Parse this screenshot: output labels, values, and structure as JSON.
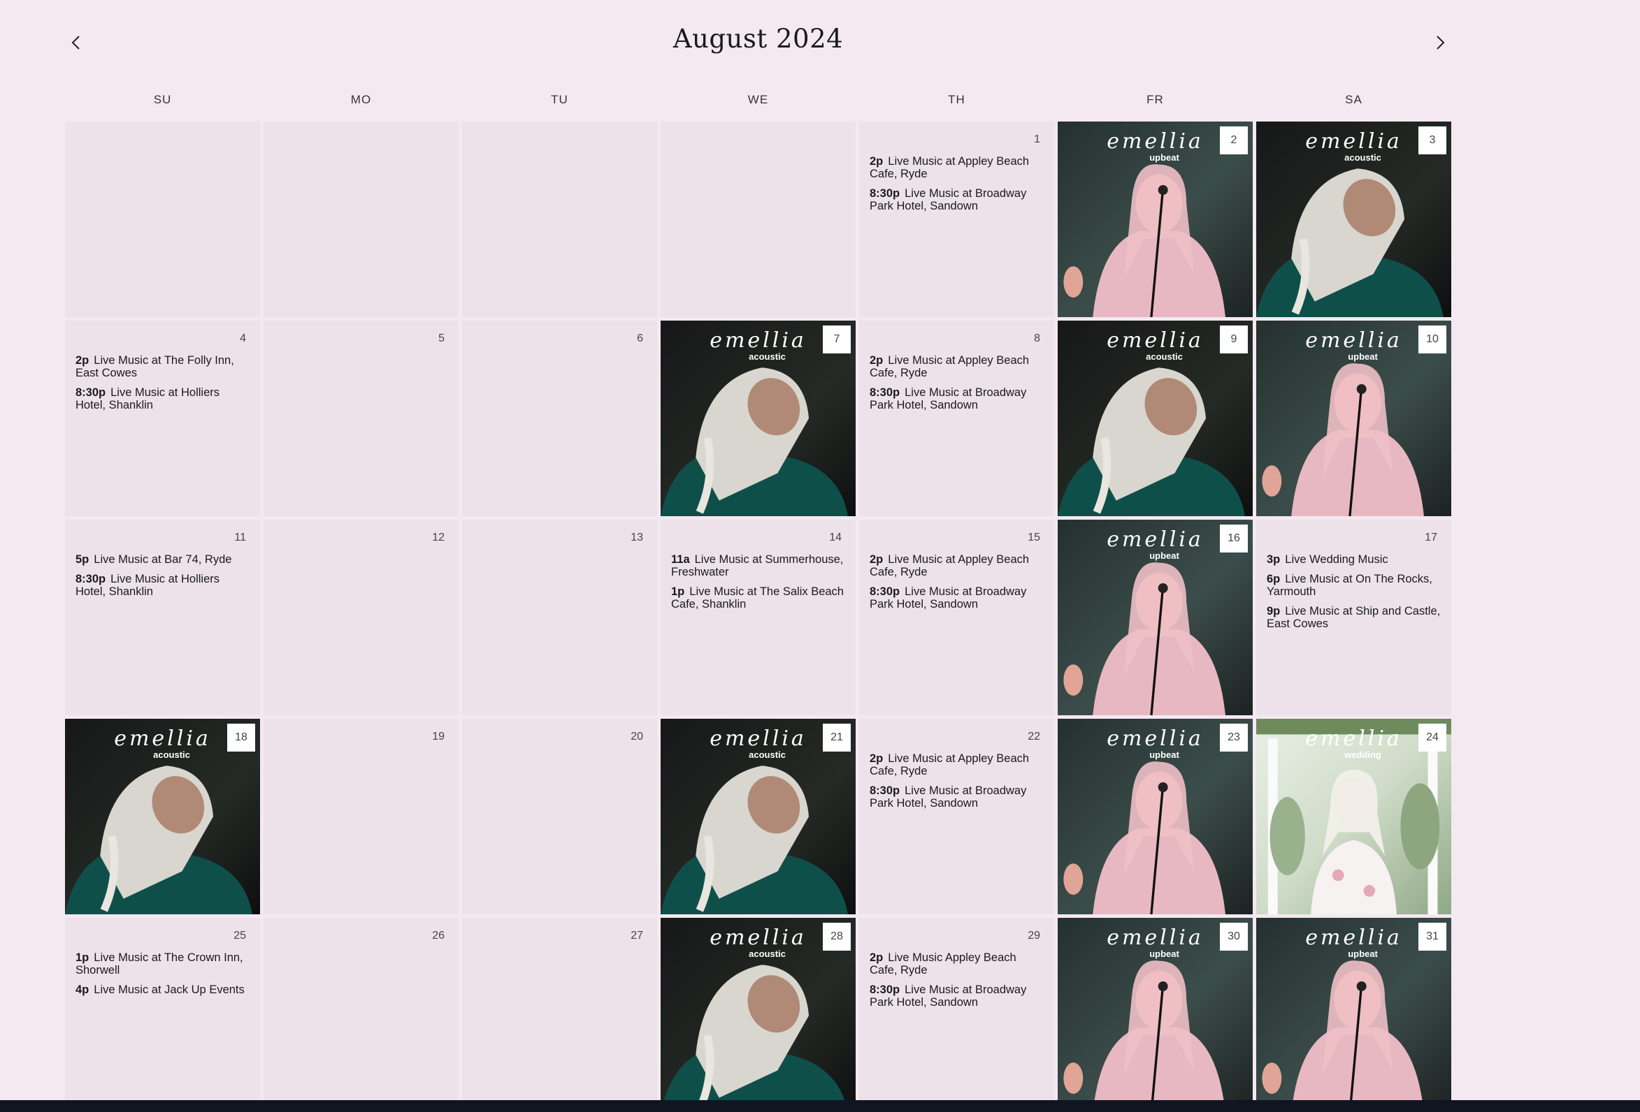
{
  "calendar": {
    "title": "August 2024",
    "prev_icon": "chevron-left-icon",
    "next_icon": "chevron-right-icon",
    "weekdays": [
      "SU",
      "MO",
      "TU",
      "WE",
      "TH",
      "FR",
      "SA"
    ]
  },
  "logo": {
    "script": "emellia"
  },
  "colors": {
    "background": "#f4e9f1",
    "cell": "#ede2ea",
    "bottom_bar": "#0f1622"
  },
  "days": [
    {
      "type": "empty"
    },
    {
      "type": "empty"
    },
    {
      "type": "empty"
    },
    {
      "type": "empty"
    },
    {
      "type": "events",
      "num": "1",
      "events": [
        {
          "time": "2p",
          "title": "Live Music at Appley Beach Cafe, Ryde"
        },
        {
          "time": "8:30p",
          "title": "Live Music at Broadway Park Hotel, Sandown"
        }
      ]
    },
    {
      "type": "image",
      "num": "2",
      "variant": "upbeat",
      "photo": "upbeat"
    },
    {
      "type": "image",
      "num": "3",
      "variant": "acoustic",
      "photo": "acoustic"
    },
    {
      "type": "events",
      "num": "4",
      "events": [
        {
          "time": "2p",
          "title": "Live Music at The Folly Inn, East Cowes"
        },
        {
          "time": "8:30p",
          "title": "Live Music at Holliers Hotel, Shanklin"
        }
      ]
    },
    {
      "type": "events",
      "num": "5",
      "events": []
    },
    {
      "type": "events",
      "num": "6",
      "events": []
    },
    {
      "type": "image",
      "num": "7",
      "variant": "acoustic",
      "photo": "acoustic"
    },
    {
      "type": "events",
      "num": "8",
      "events": [
        {
          "time": "2p",
          "title": "Live Music at Appley Beach Cafe, Ryde"
        },
        {
          "time": "8:30p",
          "title": "Live Music at Broadway Park Hotel, Sandown"
        }
      ]
    },
    {
      "type": "image",
      "num": "9",
      "variant": "acoustic",
      "photo": "acoustic"
    },
    {
      "type": "image",
      "num": "10",
      "variant": "upbeat",
      "photo": "upbeat"
    },
    {
      "type": "events",
      "num": "11",
      "events": [
        {
          "time": "5p",
          "title": "Live Music at Bar 74, Ryde"
        },
        {
          "time": "8:30p",
          "title": "Live Music at Holliers Hotel, Shanklin"
        }
      ]
    },
    {
      "type": "events",
      "num": "12",
      "events": []
    },
    {
      "type": "events",
      "num": "13",
      "events": []
    },
    {
      "type": "events",
      "num": "14",
      "events": [
        {
          "time": "11a",
          "title": "Live Music at Summerhouse, Freshwater"
        },
        {
          "time": "1p",
          "title": "Live Music at The Salix Beach Cafe, Shanklin"
        }
      ]
    },
    {
      "type": "events",
      "num": "15",
      "events": [
        {
          "time": "2p",
          "title": "Live Music at Appley Beach Cafe, Ryde"
        },
        {
          "time": "8:30p",
          "title": "Live Music at Broadway Park Hotel, Sandown"
        }
      ]
    },
    {
      "type": "image",
      "num": "16",
      "variant": "upbeat",
      "photo": "upbeat"
    },
    {
      "type": "events",
      "num": "17",
      "events": [
        {
          "time": "3p",
          "title": "Live Wedding Music"
        },
        {
          "time": "6p",
          "title": "Live Music at On The Rocks, Yarmouth"
        },
        {
          "time": "9p",
          "title": "Live Music at Ship and Castle, East Cowes"
        }
      ]
    },
    {
      "type": "image",
      "num": "18",
      "variant": "acoustic",
      "photo": "acoustic"
    },
    {
      "type": "events",
      "num": "19",
      "events": []
    },
    {
      "type": "events",
      "num": "20",
      "events": []
    },
    {
      "type": "image",
      "num": "21",
      "variant": "acoustic",
      "photo": "acoustic"
    },
    {
      "type": "events",
      "num": "22",
      "events": [
        {
          "time": "2p",
          "title": "Live Music at Appley Beach Cafe, Ryde"
        },
        {
          "time": "8:30p",
          "title": "Live Music at Broadway Park Hotel, Sandown"
        }
      ]
    },
    {
      "type": "image",
      "num": "23",
      "variant": "upbeat",
      "photo": "upbeat"
    },
    {
      "type": "image",
      "num": "24",
      "variant": "wedding",
      "photo": "wedding"
    },
    {
      "type": "events",
      "num": "25",
      "events": [
        {
          "time": "1p",
          "title": "Live Music at The Crown Inn, Shorwell"
        },
        {
          "time": "4p",
          "title": "Live Music at Jack Up Events"
        }
      ]
    },
    {
      "type": "events",
      "num": "26",
      "events": []
    },
    {
      "type": "events",
      "num": "27",
      "events": []
    },
    {
      "type": "image",
      "num": "28",
      "variant": "acoustic",
      "photo": "acoustic"
    },
    {
      "type": "events",
      "num": "29",
      "events": [
        {
          "time": "2p",
          "title": "Live Music Appley Beach Cafe, Ryde"
        },
        {
          "time": "8:30p",
          "title": "Live Music at Broadway Park Hotel, Sandown"
        }
      ]
    },
    {
      "type": "image",
      "num": "30",
      "variant": "upbeat",
      "photo": "upbeat"
    },
    {
      "type": "image",
      "num": "31",
      "variant": "upbeat",
      "photo": "upbeat"
    }
  ]
}
